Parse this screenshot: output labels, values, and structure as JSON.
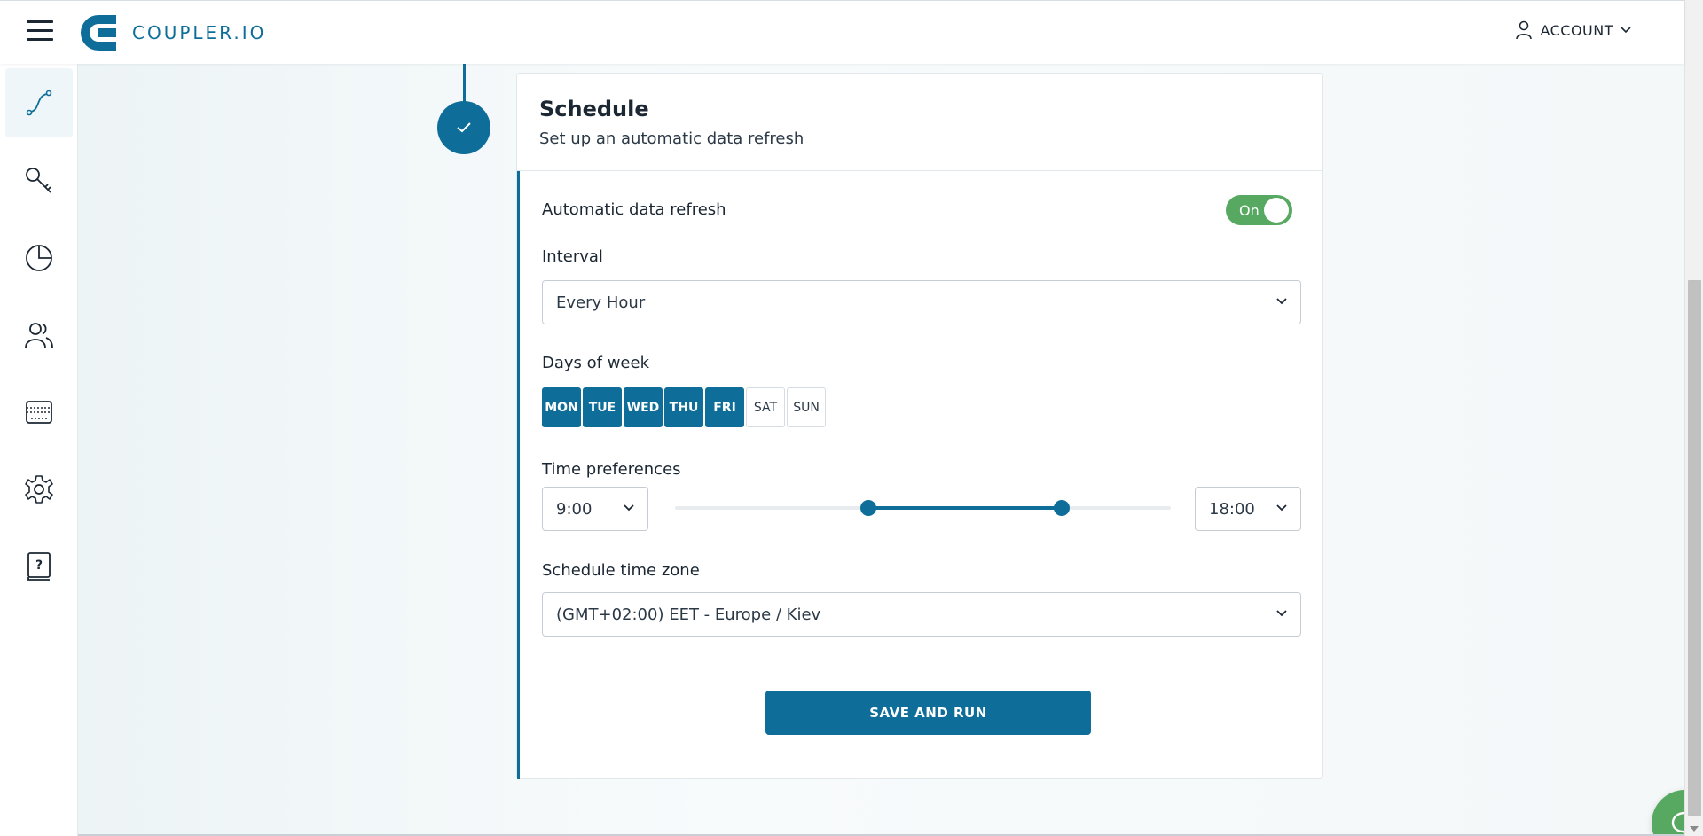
{
  "header": {
    "logo_text": "COUPLER.IO",
    "account_label": "ACCOUNT"
  },
  "sidebar": {
    "items": [
      {
        "name": "importers",
        "icon": "route-icon",
        "active": true
      },
      {
        "name": "connections",
        "icon": "key-icon",
        "active": false
      },
      {
        "name": "dashboards",
        "icon": "pie-chart-icon",
        "active": false
      },
      {
        "name": "team",
        "icon": "users-icon",
        "active": false
      },
      {
        "name": "billing",
        "icon": "credit-card-icon",
        "active": false
      },
      {
        "name": "settings",
        "icon": "gear-icon",
        "active": false
      },
      {
        "name": "help",
        "icon": "help-book-icon",
        "active": false
      }
    ]
  },
  "schedule": {
    "title": "Schedule",
    "subtitle": "Set up an automatic data refresh",
    "auto_refresh_label": "Automatic data refresh",
    "auto_refresh_state": "On",
    "interval_label": "Interval",
    "interval_value": "Every Hour",
    "days_label": "Days of week",
    "days": [
      {
        "label": "MON",
        "selected": true
      },
      {
        "label": "TUE",
        "selected": true
      },
      {
        "label": "WED",
        "selected": true
      },
      {
        "label": "THU",
        "selected": true
      },
      {
        "label": "FRI",
        "selected": true
      },
      {
        "label": "SAT",
        "selected": false
      },
      {
        "label": "SUN",
        "selected": false
      }
    ],
    "time_pref_label": "Time preferences",
    "time_from": "9:00",
    "time_to": "18:00",
    "slider_range_fraction": [
      0.39,
      0.78
    ],
    "timezone_label": "Schedule time zone",
    "timezone_value": "(GMT+02:00) EET - Europe / Kiev",
    "save_label": "SAVE AND RUN"
  },
  "colors": {
    "brand": "#0f6e99",
    "toggle_on": "#57a962",
    "chat": "#57a962"
  }
}
